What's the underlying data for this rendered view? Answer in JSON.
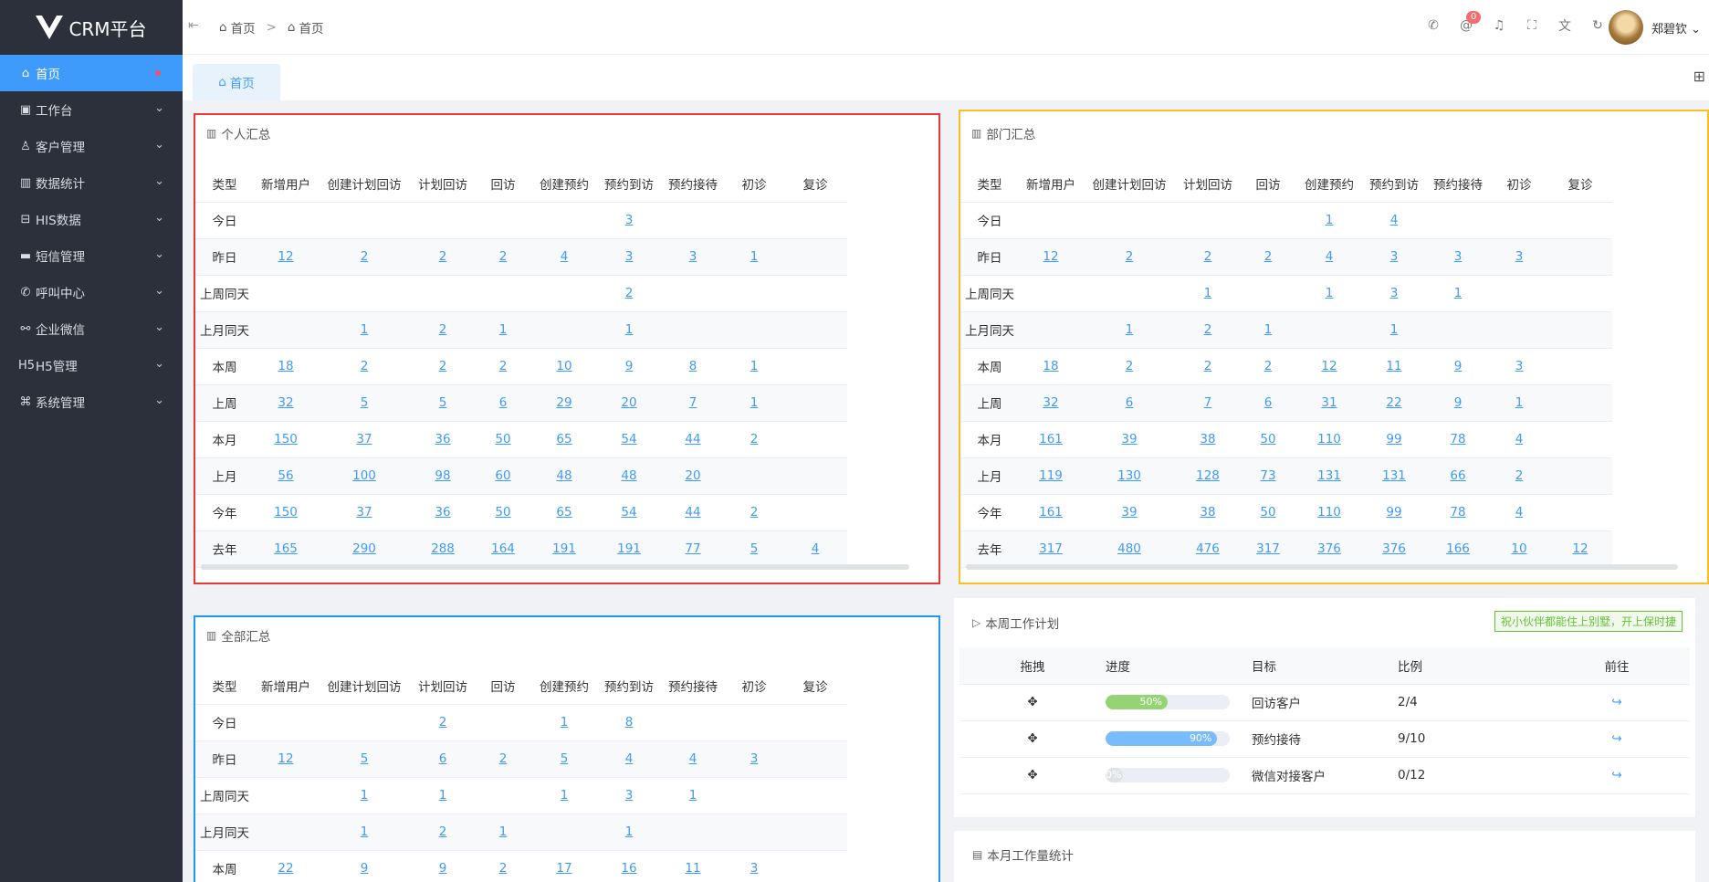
{
  "app": {
    "title": "CRM平台"
  },
  "sidebar": {
    "items": [
      {
        "label": "首页",
        "icon": "home-icon",
        "glyph": "⌂"
      },
      {
        "label": "工作台",
        "icon": "briefcase-icon",
        "glyph": "▣"
      },
      {
        "label": "客户管理",
        "icon": "user-icon",
        "glyph": "♙"
      },
      {
        "label": "数据统计",
        "icon": "bar-chart-icon",
        "glyph": "▥"
      },
      {
        "label": "HIS数据",
        "icon": "database-icon",
        "glyph": "⊟"
      },
      {
        "label": "短信管理",
        "icon": "message-icon",
        "glyph": "▬"
      },
      {
        "label": "呼叫中心",
        "icon": "phone-icon",
        "glyph": "✆"
      },
      {
        "label": "企业微信",
        "icon": "wechat-icon",
        "glyph": "⚯"
      },
      {
        "label": "H5管理",
        "icon": "h5-icon",
        "glyph": "H5"
      },
      {
        "label": "系统管理",
        "icon": "command-icon",
        "glyph": "⌘"
      }
    ]
  },
  "header": {
    "breadcrumb": [
      "首页",
      "首页"
    ],
    "separator": ">",
    "notification_count": "0",
    "username": "郑碧钦"
  },
  "tabs": [
    {
      "label": "首页"
    }
  ],
  "columns": [
    "类型",
    "新增用户",
    "创建计划回访",
    "计划回访",
    "回访",
    "创建预约",
    "预约到访",
    "预约接待",
    "初诊",
    "复诊"
  ],
  "personal": {
    "title": "个人汇总",
    "rows": [
      [
        "今日",
        "",
        "",
        "",
        "",
        "",
        "3",
        "",
        "",
        ""
      ],
      [
        "昨日",
        "12",
        "2",
        "2",
        "2",
        "4",
        "3",
        "3",
        "1",
        ""
      ],
      [
        "上周同天",
        "",
        "",
        "",
        "",
        "",
        "2",
        "",
        "",
        ""
      ],
      [
        "上月同天",
        "",
        "1",
        "2",
        "1",
        "",
        "1",
        "",
        "",
        ""
      ],
      [
        "本周",
        "18",
        "2",
        "2",
        "2",
        "10",
        "9",
        "8",
        "1",
        ""
      ],
      [
        "上周",
        "32",
        "5",
        "5",
        "6",
        "29",
        "20",
        "7",
        "1",
        ""
      ],
      [
        "本月",
        "150",
        "37",
        "36",
        "50",
        "65",
        "54",
        "44",
        "2",
        ""
      ],
      [
        "上月",
        "56",
        "100",
        "98",
        "60",
        "48",
        "48",
        "20",
        "",
        ""
      ],
      [
        "今年",
        "150",
        "37",
        "36",
        "50",
        "65",
        "54",
        "44",
        "2",
        ""
      ],
      [
        "去年",
        "165",
        "290",
        "288",
        "164",
        "191",
        "191",
        "77",
        "5",
        "4"
      ]
    ]
  },
  "department": {
    "title": "部门汇总",
    "rows": [
      [
        "今日",
        "",
        "",
        "",
        "",
        "1",
        "4",
        "",
        "",
        ""
      ],
      [
        "昨日",
        "12",
        "2",
        "2",
        "2",
        "4",
        "3",
        "3",
        "3",
        ""
      ],
      [
        "上周同天",
        "",
        "",
        "1",
        "",
        "1",
        "3",
        "1",
        "",
        ""
      ],
      [
        "上月同天",
        "",
        "1",
        "2",
        "1",
        "",
        "1",
        "",
        "",
        ""
      ],
      [
        "本周",
        "18",
        "2",
        "2",
        "2",
        "12",
        "11",
        "9",
        "3",
        ""
      ],
      [
        "上周",
        "32",
        "6",
        "7",
        "6",
        "31",
        "22",
        "9",
        "1",
        ""
      ],
      [
        "本月",
        "161",
        "39",
        "38",
        "50",
        "110",
        "99",
        "78",
        "4",
        ""
      ],
      [
        "上月",
        "119",
        "130",
        "128",
        "73",
        "131",
        "131",
        "66",
        "2",
        ""
      ],
      [
        "今年",
        "161",
        "39",
        "38",
        "50",
        "110",
        "99",
        "78",
        "4",
        ""
      ],
      [
        "去年",
        "317",
        "480",
        "476",
        "317",
        "376",
        "376",
        "166",
        "10",
        "12"
      ]
    ]
  },
  "all": {
    "title": "全部汇总",
    "rows": [
      [
        "今日",
        "",
        "",
        "2",
        "",
        "1",
        "8",
        "",
        "",
        ""
      ],
      [
        "昨日",
        "12",
        "5",
        "6",
        "2",
        "5",
        "4",
        "4",
        "3",
        ""
      ],
      [
        "上周同天",
        "",
        "1",
        "1",
        "",
        "1",
        "3",
        "1",
        "",
        ""
      ],
      [
        "上月同天",
        "",
        "1",
        "2",
        "1",
        "",
        "1",
        "",
        "",
        ""
      ],
      [
        "本周",
        "22",
        "9",
        "9",
        "2",
        "17",
        "16",
        "11",
        "3",
        ""
      ]
    ]
  },
  "plan": {
    "title": "本周工作计划",
    "tag": "祝小伙伴都能住上别墅，开上保时捷",
    "columns": [
      "拖拽",
      "进度",
      "目标",
      "比例",
      "前往"
    ],
    "rows": [
      {
        "progress": 50,
        "progress_label": "50%",
        "color": "#95d475",
        "target": "回访客户",
        "ratio": "2/4"
      },
      {
        "progress": 90,
        "progress_label": "90%",
        "color": "#79bbff",
        "target": "预约接待",
        "ratio": "9/10"
      },
      {
        "progress": 0,
        "progress_label": "0%",
        "color": "#dfe2e6",
        "target": "微信对接客户",
        "ratio": "0/12"
      }
    ]
  },
  "bottom": {
    "title": "本月工作量统计"
  }
}
